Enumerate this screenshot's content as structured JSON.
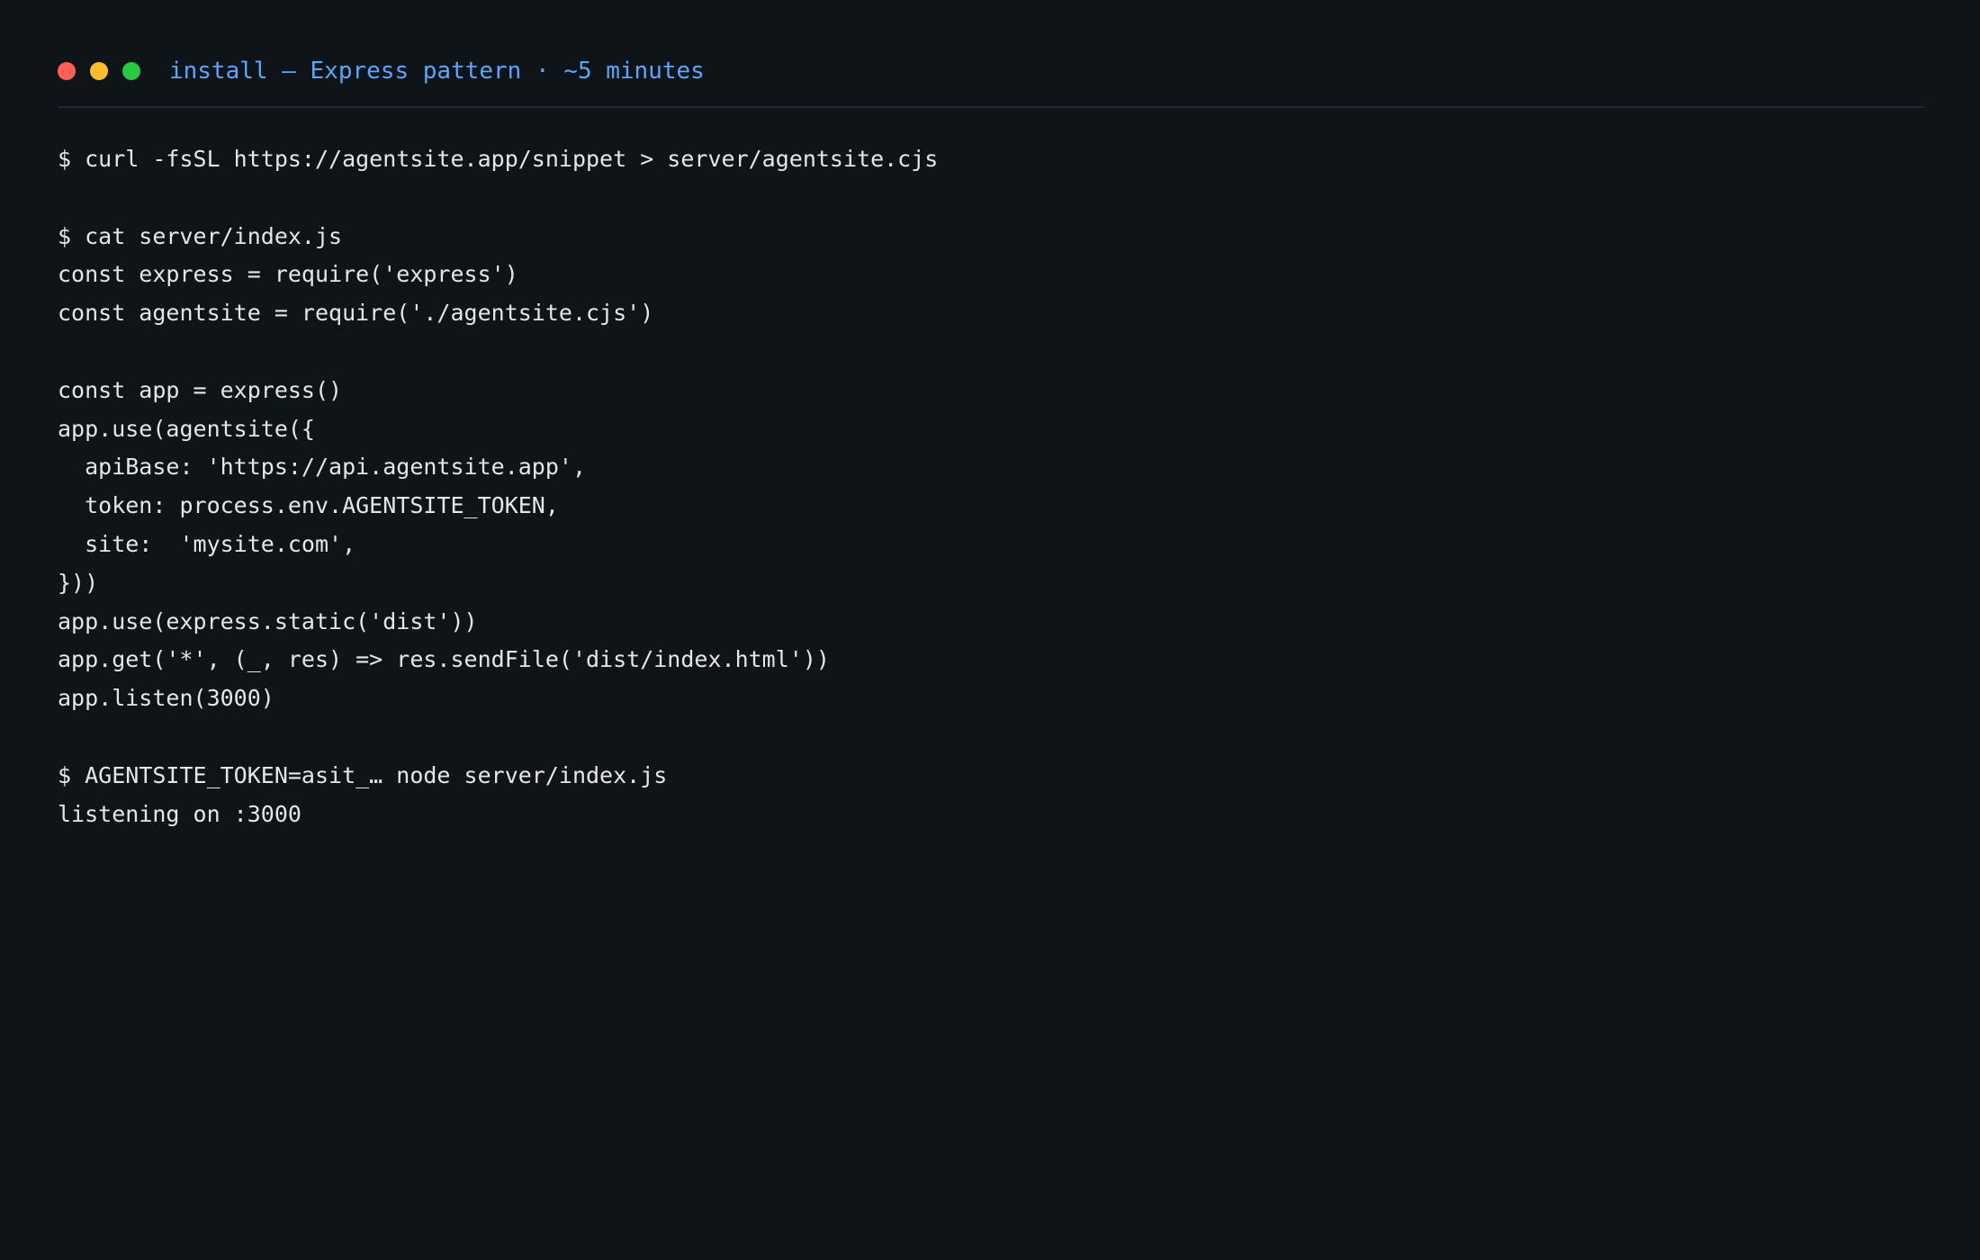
{
  "window": {
    "title": "install — Express pattern · ~5 minutes",
    "title_color": "#58a6ff",
    "traffic_lights": [
      {
        "name": "close",
        "color": "#ff5f56"
      },
      {
        "name": "minimize",
        "color": "#ffbd2e"
      },
      {
        "name": "maximize",
        "color": "#27c93f"
      }
    ]
  },
  "theme": {
    "background": "#0f1419",
    "text": "#e6e6e6",
    "divider": "#232a33"
  },
  "terminal": {
    "lines": [
      "$ curl -fsSL https://agentsite.app/snippet > server/agentsite.cjs",
      "",
      "$ cat server/index.js",
      "const express = require('express')",
      "const agentsite = require('./agentsite.cjs')",
      "",
      "const app = express()",
      "app.use(agentsite({",
      "  apiBase: 'https://api.agentsite.app',",
      "  token: process.env.AGENTSITE_TOKEN,",
      "  site:  'mysite.com',",
      "}))",
      "app.use(express.static('dist'))",
      "app.get('*', (_, res) => res.sendFile('dist/index.html'))",
      "app.listen(3000)",
      "",
      "$ AGENTSITE_TOKEN=asit_… node server/index.js",
      "listening on :3000"
    ]
  }
}
